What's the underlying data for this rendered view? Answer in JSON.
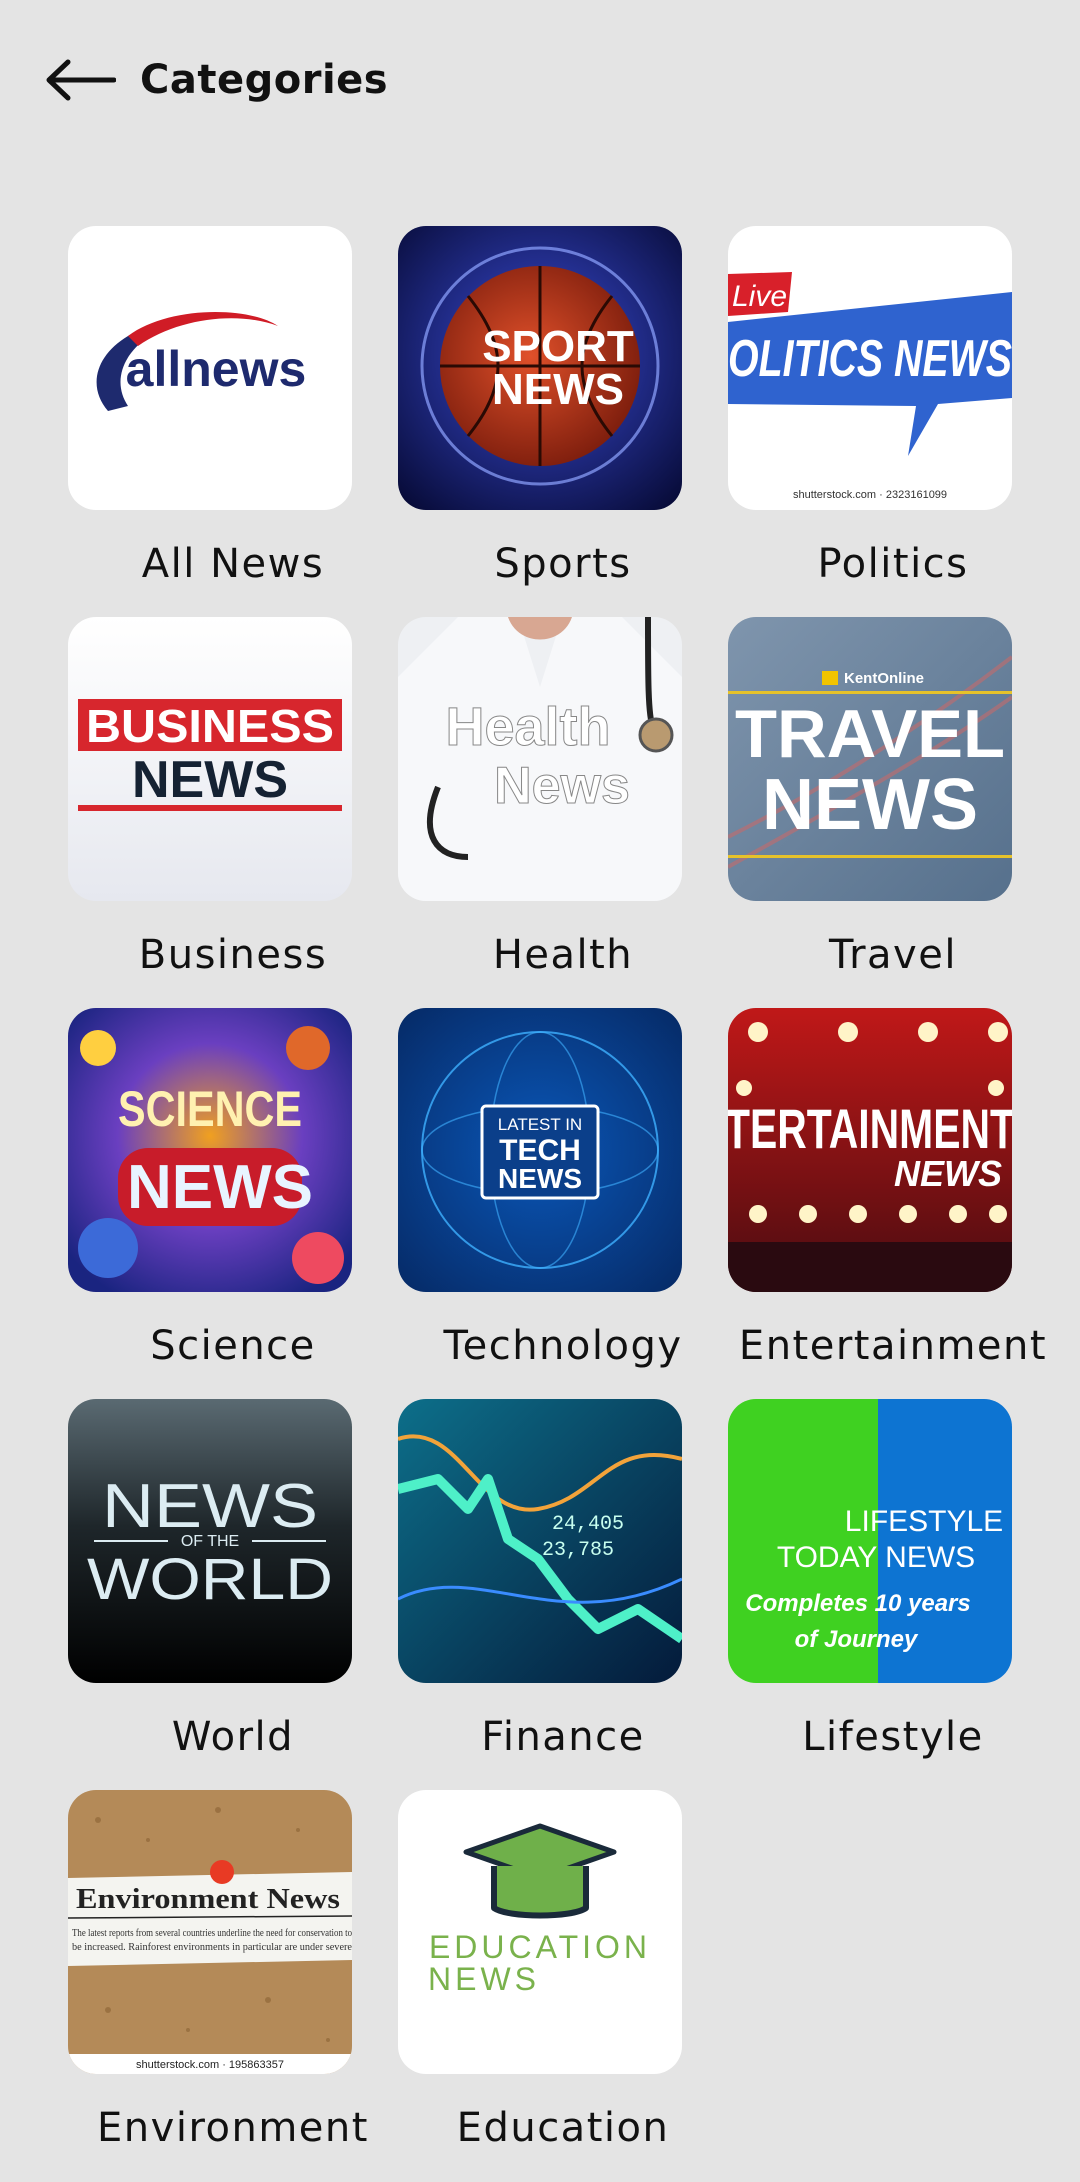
{
  "header": {
    "title": "Categories",
    "back_icon": "arrow-left-icon"
  },
  "categories": [
    {
      "label": "All News",
      "image_text": [
        "allnews"
      ]
    },
    {
      "label": "Sports",
      "image_text": [
        "SPORT",
        "NEWS"
      ]
    },
    {
      "label": "Politics",
      "image_text": [
        "Live",
        "OLITICS NEWS",
        "shutterstock.com · 2323161099"
      ]
    },
    {
      "label": "Business",
      "image_text": [
        "BUSINESS",
        "NEWS"
      ]
    },
    {
      "label": "Health",
      "image_text": [
        "Health",
        "News"
      ]
    },
    {
      "label": "Travel",
      "image_text": [
        "KentOnline",
        "TRAVEL",
        "NEWS"
      ]
    },
    {
      "label": "Science",
      "image_text": [
        "SCIENCE",
        "NEWS"
      ]
    },
    {
      "label": "Technology",
      "image_text": [
        "LATEST IN",
        "TECH",
        "NEWS"
      ]
    },
    {
      "label": "Entertainment",
      "image_text": [
        "TERTAINMENT",
        "NEWS"
      ]
    },
    {
      "label": "World",
      "image_text": [
        "NEWS",
        "OF THE",
        "WORLD"
      ]
    },
    {
      "label": "Finance",
      "image_text": [
        "24,405",
        "23,785"
      ]
    },
    {
      "label": "Lifestyle",
      "image_text": [
        "LIFESTYLE",
        "TODAY NEWS",
        "Completes 10 years",
        "of Journey"
      ]
    },
    {
      "label": "Environment",
      "image_text": [
        "Environment News",
        "The latest reports from several countries underline the need for conservation to",
        "be increased. Rainforest environments in particular are under severe",
        "shutterstock.com · 195863357"
      ]
    },
    {
      "label": "Education",
      "image_text": [
        "EDUCATION",
        "NEWS"
      ]
    }
  ]
}
